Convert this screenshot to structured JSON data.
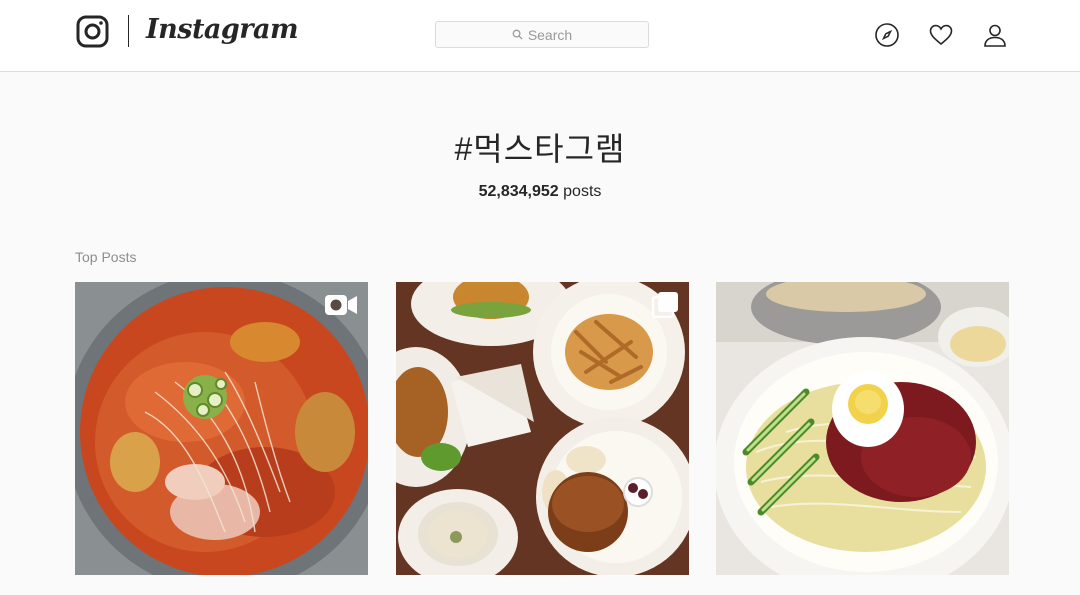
{
  "header": {
    "brand_name": "Instagram",
    "search_placeholder": "Search",
    "nav_icons": [
      "compass-icon",
      "heart-icon",
      "user-icon"
    ]
  },
  "hashtag": {
    "title": "#먹스타그램",
    "post_count": "52,834,952",
    "post_unit": "posts"
  },
  "section": {
    "top_posts_label": "Top Posts"
  },
  "top_posts": [
    {
      "type": "video",
      "overlay_icon": "video-camera-icon"
    },
    {
      "type": "carousel",
      "overlay_icon": "multiple-photos-icon"
    },
    {
      "type": "photo"
    }
  ],
  "colors": {
    "background": "#fafafa",
    "header_bg": "#ffffff",
    "border": "#dbdbdb",
    "text": "#262626",
    "muted": "#8e8e8e"
  }
}
